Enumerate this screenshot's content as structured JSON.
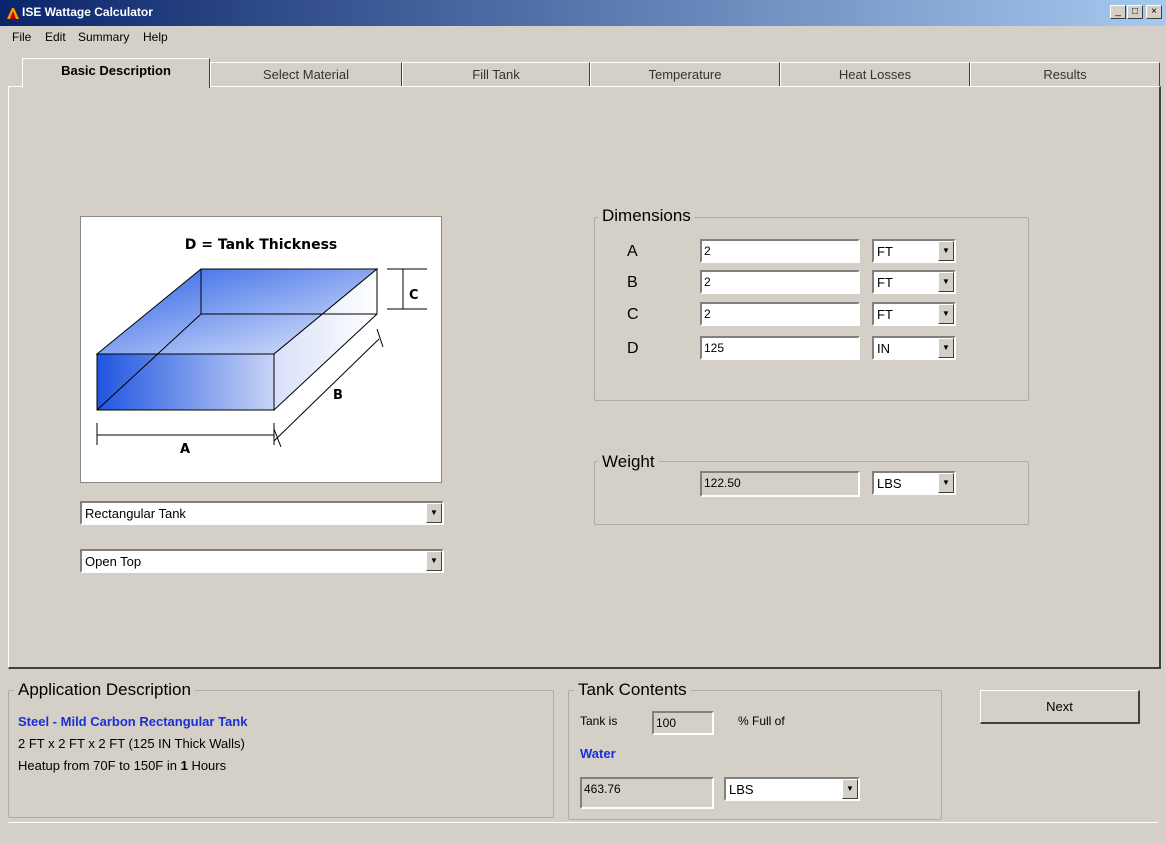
{
  "window": {
    "title": "ISE Wattage Calculator",
    "controls": [
      "_",
      "□",
      "×"
    ]
  },
  "menu": [
    "File",
    "Edit",
    "Summary",
    "Help"
  ],
  "tabs": [
    {
      "label": "Basic Description",
      "active": true
    },
    {
      "label": "Select Material",
      "active": false
    },
    {
      "label": "Fill Tank",
      "active": false
    },
    {
      "label": "Temperature",
      "active": false
    },
    {
      "label": "Heat Losses",
      "active": false
    },
    {
      "label": "Results",
      "active": false
    }
  ],
  "diagram": {
    "title": "D = Tank Thickness",
    "label_a": "A",
    "label_b": "B",
    "label_c": "C"
  },
  "tank_shape": {
    "selected": "Rectangular Tank"
  },
  "tank_top": {
    "selected": "Open Top"
  },
  "dimensions": {
    "title": "Dimensions",
    "rows": [
      {
        "label": "A",
        "value": "2",
        "unit": "FT"
      },
      {
        "label": "B",
        "value": "2",
        "unit": "FT"
      },
      {
        "label": "C",
        "value": "2",
        "unit": "FT"
      },
      {
        "label": "D",
        "value": "125",
        "unit": "IN"
      }
    ]
  },
  "weight": {
    "title": "Weight",
    "value": "122.50",
    "unit": "LBS"
  },
  "application": {
    "title": "Application Description",
    "line1": "Steel - Mild Carbon Rectangular Tank",
    "line2": "2 FT x 2  FT x 2 FT (125 IN Thick Walls)",
    "line3_prefix": "Heatup from 70F to 150F in ",
    "line3_hours": "1",
    "line3_suffix": " Hours"
  },
  "tank_contents": {
    "title": "Tank Contents",
    "tank_is_label": "Tank is",
    "percent": "100",
    "percent_label": "% Full of",
    "substance": "Water",
    "weight_value": "463.76",
    "weight_unit": "LBS"
  },
  "next_button": "Next",
  "colors": {
    "titlebar_start": "#0a246a",
    "titlebar_end": "#a6caf0",
    "accent_text": "#1a2fd4",
    "tank_blue": "#1f55e0"
  }
}
